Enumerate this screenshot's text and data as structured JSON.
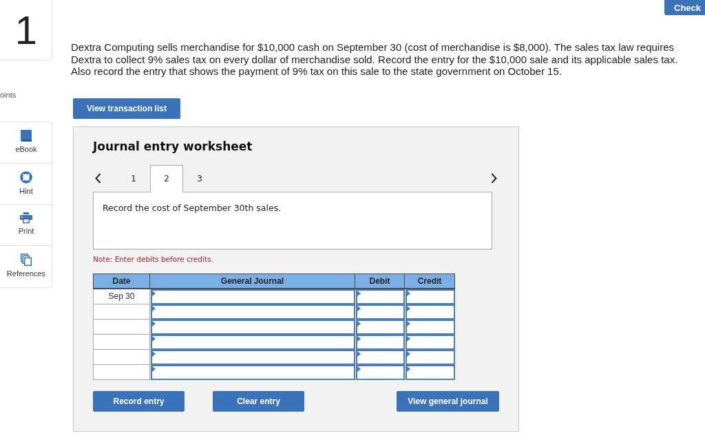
{
  "question_card": {
    "number": "1"
  },
  "points_label": "oints",
  "sidebar": {
    "items": [
      {
        "kind": "ebook",
        "label": "eBook"
      },
      {
        "kind": "hint",
        "label": "Hint"
      },
      {
        "kind": "print",
        "label": "Print"
      },
      {
        "kind": "references",
        "label": "References"
      }
    ]
  },
  "check_button": "Check",
  "question": "Dextra Computing sells merchandise for $10,000 cash on September 30 (cost of merchandise is $8,000). The sales tax law requires Dextra to collect 9% sales tax on every dollar of merchandise sold. Record the entry for the $10,000 sale and its applicable sales tax. Also record the entry that shows the payment of 9% tax on this sale to the state government on October 15.",
  "transaction_button": "View transaction list",
  "worksheet": {
    "title": "Journal entry worksheet",
    "tabs": [
      {
        "label": "1",
        "selected": false
      },
      {
        "label": "2",
        "selected": true
      },
      {
        "label": "3",
        "selected": false
      }
    ],
    "instruction": "Record the cost of September 30th sales.",
    "note": "Note: Enter debits before credits.",
    "table": {
      "columns": [
        "Date",
        "General Journal",
        "Debit",
        "Credit"
      ],
      "rows": [
        {
          "date": "Sep 30"
        },
        {},
        {},
        {},
        {},
        {}
      ]
    },
    "buttons": [
      "Record entry",
      "Clear entry",
      "View general journal"
    ]
  }
}
